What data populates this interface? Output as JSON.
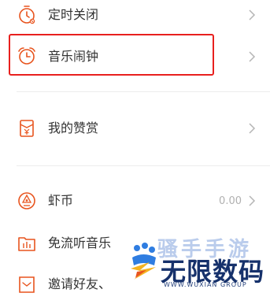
{
  "menu": {
    "items": [
      {
        "label": "定时关闭",
        "icon": "timer-icon"
      },
      {
        "label": "音乐闹钟",
        "icon": "alarm-clock-icon"
      },
      {
        "label": "我的赞赏",
        "icon": "red-envelope-icon"
      },
      {
        "label": "虾币",
        "icon": "coin-icon",
        "value": "0.00"
      },
      {
        "label": "免流听音乐",
        "icon": "free-data-music-icon"
      },
      {
        "label": "邀请好友、",
        "icon": "invite-friend-icon"
      }
    ]
  },
  "watermark": {
    "top_text": "骚手手游",
    "main_text": "无限数码",
    "sub_text": "WWW.WUXIAN GROUP"
  },
  "colors": {
    "accent": "#e8541e",
    "highlight_border": "#e8201e",
    "text": "#333333",
    "muted": "#b0b0b0",
    "chevron": "#b5b5b5",
    "divider": "#ececec"
  }
}
